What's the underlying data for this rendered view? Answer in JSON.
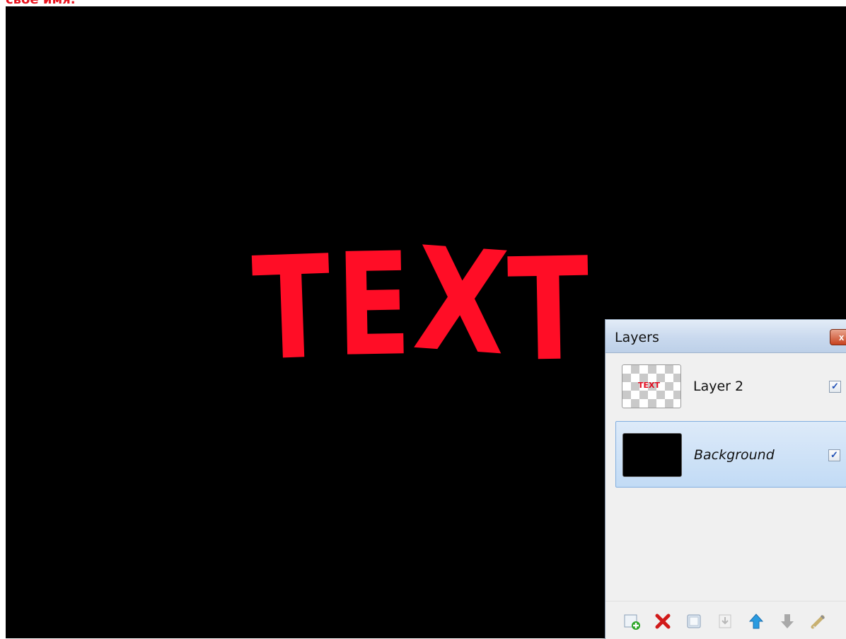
{
  "caption": "свое имя.",
  "canvas": {
    "background": "#000000",
    "art_text": [
      "T",
      "E",
      "X",
      "T"
    ],
    "art_color": "#ff0d26"
  },
  "layers_panel": {
    "title": "Layers",
    "close_label": "x",
    "layers": [
      {
        "name": "Layer 2",
        "thumbnail_text": "TEXT",
        "visible_mark": "✓"
      },
      {
        "name": "Background",
        "visible_mark": "✓",
        "selected": true
      }
    ],
    "toolbar": [
      "add-layer-icon",
      "delete-layer-icon",
      "duplicate-layer-icon",
      "merge-layer-down-icon",
      "move-layer-up-icon",
      "move-layer-down-icon",
      "layer-properties-icon"
    ]
  }
}
